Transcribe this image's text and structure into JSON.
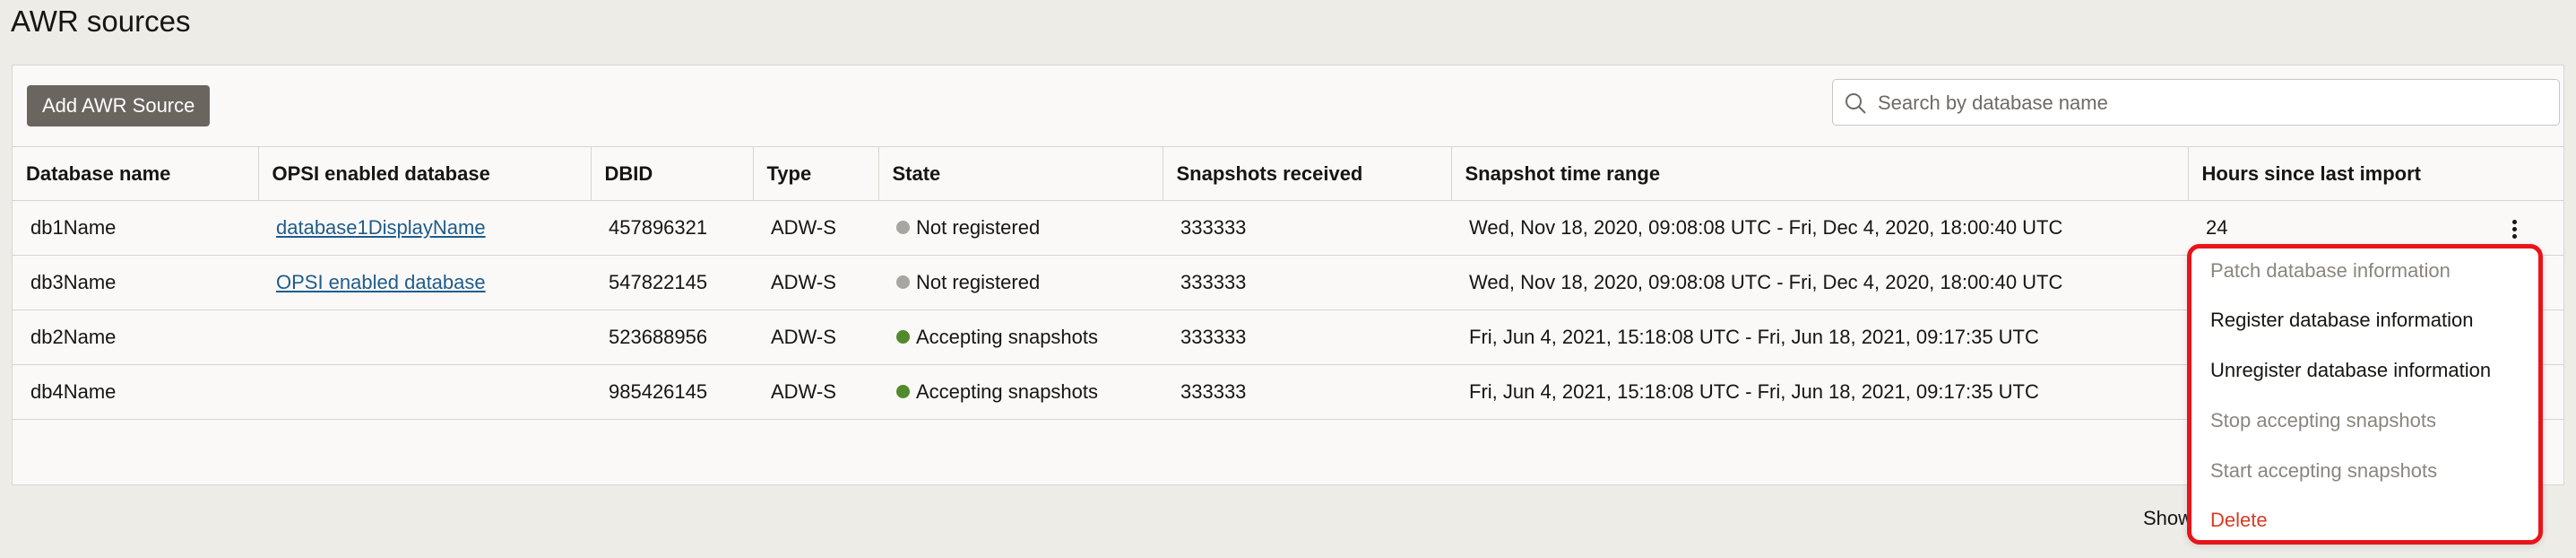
{
  "page": {
    "title": "AWR sources"
  },
  "toolbar": {
    "add_label": "Add AWR Source",
    "search_placeholder": "Search by database name",
    "search_value": ""
  },
  "table": {
    "columns": [
      "Database name",
      "OPSI enabled database",
      "DBID",
      "Type",
      "State",
      "Snapshots received",
      "Snapshot time range",
      "Hours since last import"
    ],
    "rows": [
      {
        "db_name": "db1Name",
        "opsi_db": "database1DisplayName",
        "dbid": "457896321",
        "type": "ADW-S",
        "state": "Not registered",
        "state_color": "#a8a6a2",
        "snapshots": "333333",
        "time_range": "Wed, Nov 18, 2020, 09:08:08 UTC - Fri, Dec 4, 2020, 18:00:40 UTC",
        "hours": "24"
      },
      {
        "db_name": "db3Name",
        "opsi_db": "OPSI enabled database",
        "dbid": "547822145",
        "type": "ADW-S",
        "state": "Not registered",
        "state_color": "#a8a6a2",
        "snapshots": "333333",
        "time_range": "Wed, Nov 18, 2020, 09:08:08 UTC - Fri, Dec 4, 2020, 18:00:40 UTC",
        "hours": ""
      },
      {
        "db_name": "db2Name",
        "opsi_db": "",
        "dbid": "523688956",
        "type": "ADW-S",
        "state": "Accepting snapshots",
        "state_color": "#508a2c",
        "snapshots": "333333",
        "time_range": "Fri, Jun 4, 2021, 15:18:08 UTC - Fri, Jun 18, 2021, 09:17:35 UTC",
        "hours": ""
      },
      {
        "db_name": "db4Name",
        "opsi_db": "",
        "dbid": "985426145",
        "type": "ADW-S",
        "state": "Accepting snapshots",
        "state_color": "#508a2c",
        "snapshots": "333333",
        "time_range": "Fri, Jun 4, 2021, 15:18:08 UTC - Fri, Jun 18, 2021, 09:17:35 UTC",
        "hours": ""
      }
    ]
  },
  "footer": {
    "text": "Showi"
  },
  "menu": {
    "patch": "Patch database information",
    "register": "Register database information",
    "unregister": "Unregister database information",
    "stop": "Stop accepting snapshots",
    "start": "Start accepting snapshots",
    "delete": "Delete"
  },
  "colors": {
    "accent_red": "#e8141a",
    "link": "#1f5c8a",
    "button": "#6b6560"
  },
  "icons": {
    "search": "search-icon",
    "actions": "kebab-menu-icon"
  }
}
